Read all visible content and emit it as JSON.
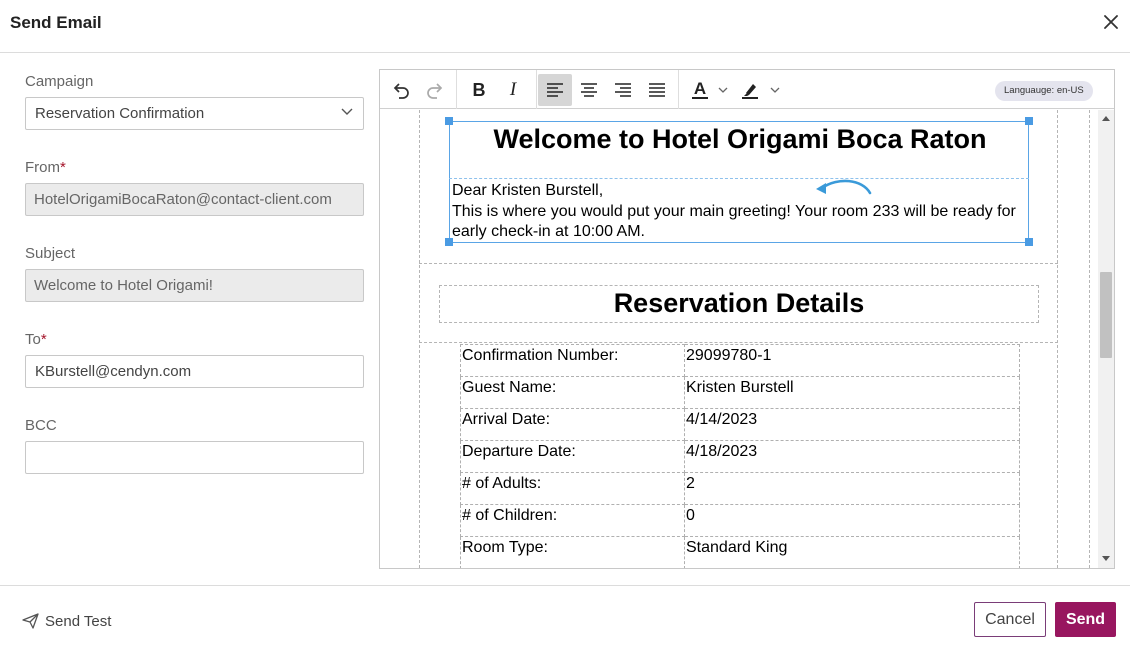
{
  "dialog": {
    "title": "Send Email",
    "close_icon": "close-icon"
  },
  "form": {
    "campaign": {
      "label": "Campaign",
      "value": "Reservation Confirmation"
    },
    "from": {
      "label": "From",
      "required_mark": "*",
      "value": "HotelOrigamiBocaRaton@contact-client.com"
    },
    "subject": {
      "label": "Subject",
      "value": "Welcome to Hotel Origami!"
    },
    "to": {
      "label": "To",
      "required_mark": "*",
      "value": "KBurstell@cendyn.com"
    },
    "bcc": {
      "label": "BCC",
      "value": ""
    }
  },
  "toolbar": {
    "icons": [
      "undo-icon",
      "redo-icon",
      "bold-icon",
      "italic-icon",
      "align-left-icon",
      "align-center-icon",
      "align-right-icon",
      "align-justify-icon",
      "font-color-icon",
      "highlight-icon"
    ],
    "bold": "B",
    "italic": "I",
    "font_color_glyph": "A",
    "language_badge": "Languauge: en-US",
    "active_alignment": "left"
  },
  "email": {
    "heading": "Welcome to Hotel Origami Boca Raton",
    "greeting_line": "Dear Kristen Burstell,",
    "body": "This is where you would put your main greeting! Your room 233 will be ready for early check-in at 10:00 AM.",
    "details_heading": "Reservation Details",
    "details": [
      {
        "label": "Confirmation Number:",
        "value": "29099780-1"
      },
      {
        "label": "Guest Name:",
        "value": "Kristen Burstell"
      },
      {
        "label": "Arrival Date:",
        "value": "4/14/2023"
      },
      {
        "label": "Departure Date:",
        "value": "4/18/2023"
      },
      {
        "label": "# of Adults:",
        "value": "2"
      },
      {
        "label": "# of Children:",
        "value": "0"
      },
      {
        "label": "Room Type:",
        "value": "Standard King"
      }
    ]
  },
  "footer": {
    "send_test": "Send Test",
    "cancel": "Cancel",
    "send": "Send"
  },
  "colors": {
    "send_button": "#98165f",
    "cancel_border": "#7a3d78",
    "required": "#a5152b",
    "selection": "#4a9be3",
    "language_badge_bg": "#e4e4ee"
  }
}
